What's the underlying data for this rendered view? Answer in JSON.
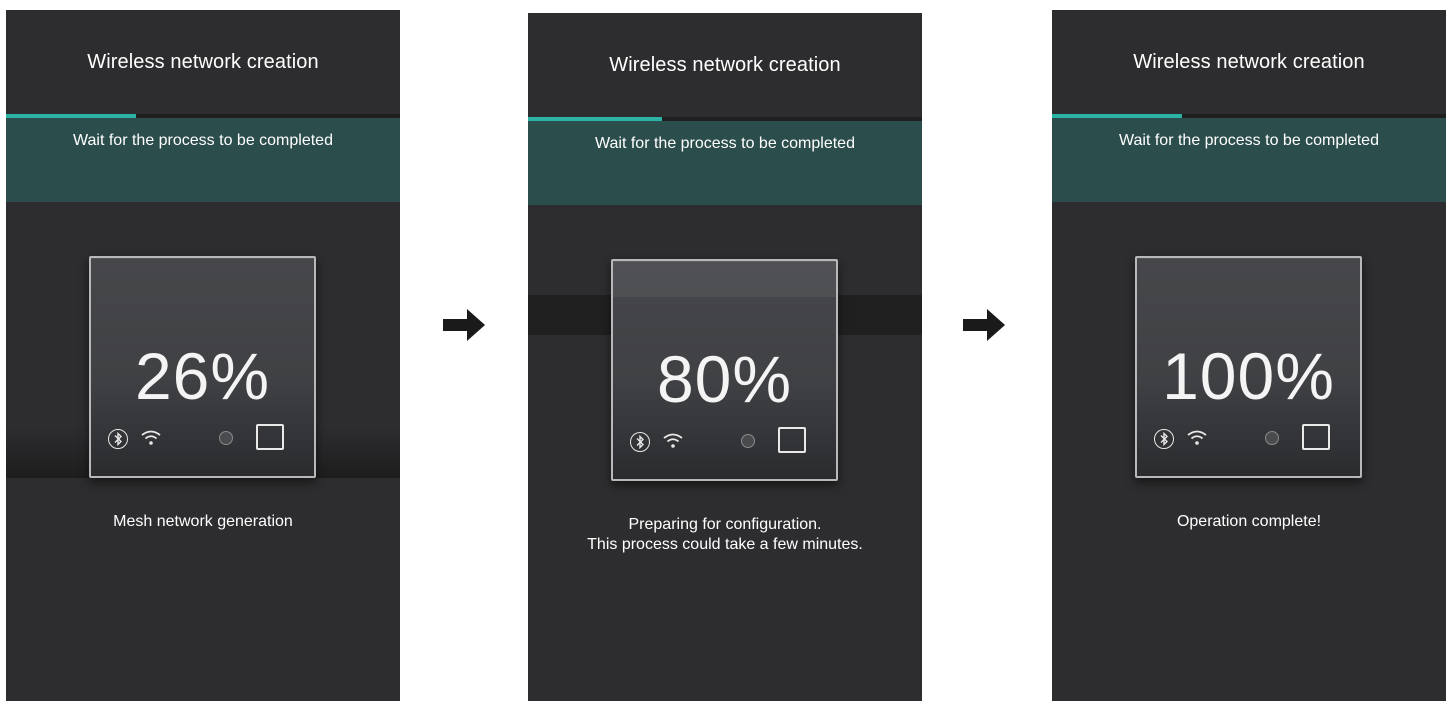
{
  "screens": [
    {
      "title": "Wireless network creation",
      "banner": "Wait for the process to be completed",
      "progress": 0.33,
      "percent": "26%",
      "caption_line1": "Mesh network generation",
      "caption_line2": ""
    },
    {
      "title": "Wireless network creation",
      "banner": "Wait for the process to be completed",
      "progress": 0.34,
      "percent": "80%",
      "caption_line1": "Preparing for configuration.",
      "caption_line2": "This process could take a few minutes."
    },
    {
      "title": "Wireless network creation",
      "banner": "Wait for the process to be completed",
      "progress": 0.33,
      "percent": "100%",
      "caption_line1": "Operation complete!",
      "caption_line2": ""
    }
  ],
  "icons": {
    "bluetooth": "bluetooth-icon",
    "wifi": "wifi-icon",
    "led": "status-led-icon",
    "square": "square-icon",
    "arrow": "right-arrow-icon"
  },
  "colors": {
    "background": "#2d2d2f",
    "accent": "#2bb3a6",
    "banner": "#2b4d4b"
  }
}
